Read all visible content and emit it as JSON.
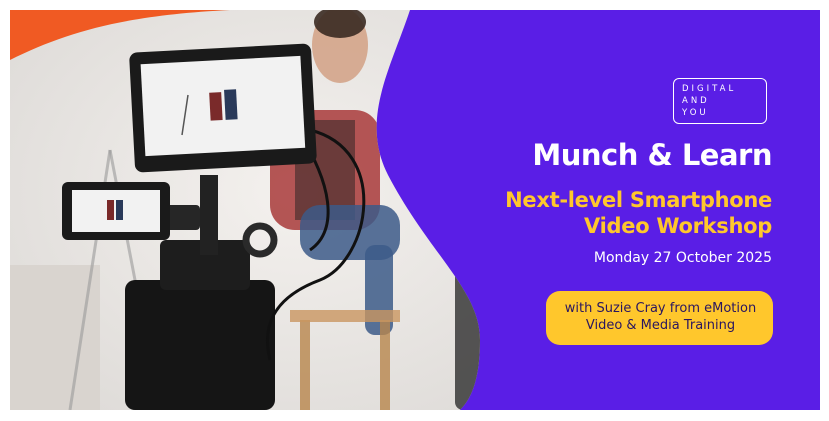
{
  "logo": {
    "line1": "DIGITAL",
    "line2": "AND",
    "line3": "YOU"
  },
  "title": "Munch & Learn",
  "subtitle": {
    "line1": "Next-level Smartphone",
    "line2": "Video Workshop"
  },
  "date": "Monday 27 October 2025",
  "presenter": {
    "line1": "with Suzie Cray from eMotion",
    "line2": "Video & Media Training"
  },
  "colors": {
    "purple": "#5a1ee6",
    "orange": "#f05a23",
    "yellow": "#ffc72c",
    "white": "#ffffff"
  }
}
